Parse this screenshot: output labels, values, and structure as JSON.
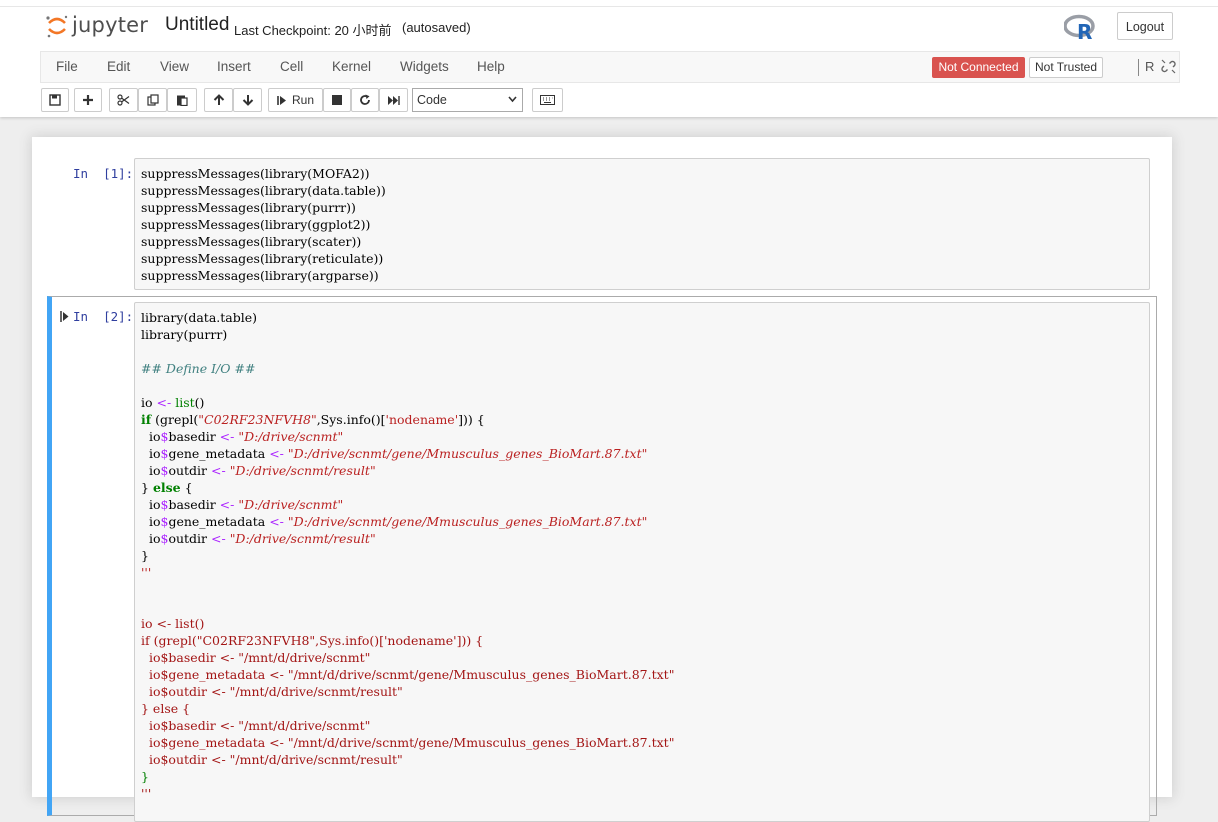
{
  "header": {
    "logo_text": "jupyter",
    "notebook_title": "Untitled",
    "checkpoint": "Last Checkpoint: 20 小时前",
    "autosave": "(autosaved)",
    "logout_label": "Logout",
    "kernel_logo": "R"
  },
  "menubar": {
    "items": [
      "File",
      "Edit",
      "View",
      "Insert",
      "Cell",
      "Kernel",
      "Widgets",
      "Help"
    ],
    "connection_status": "Not Connected",
    "trust_status": "Not Trusted",
    "kernel_name": "R",
    "status_colors": {
      "not_connected_bg": "#d9534f"
    }
  },
  "toolbar": {
    "buttons": [
      "save-icon",
      "plus-icon",
      "cut-icon",
      "copy-icon",
      "paste-icon",
      "arrow-up-icon",
      "arrow-down-icon",
      "run-button",
      "stop-icon",
      "restart-icon",
      "fast-forward-icon",
      "keyboard-icon"
    ],
    "run_label": "Run",
    "cell_type": "Code"
  },
  "cells": [
    {
      "prompt": "In  [1]:",
      "lines": [
        "suppressMessages(library(MOFA2))",
        "suppressMessages(library(data.table))",
        "suppressMessages(library(purrr))",
        "suppressMessages(library(ggplot2))",
        "suppressMessages(library(scater))",
        "suppressMessages(library(reticulate))",
        "suppressMessages(library(argparse))"
      ]
    },
    {
      "prompt": "In  [2]:",
      "code": {
        "l1": "library(data.table)",
        "l2": "library(purrr)",
        "comment": "## Define I/O ##",
        "io": "io",
        "assign": "<-",
        "list": "list",
        "paren": "()",
        "if": "if",
        "grepl_open": " (grepl(",
        "host": "\"C02RF23NFVH8\"",
        "sysinfo": ",Sys.info()[",
        "nodename": "'nodename'",
        "close": "])) {",
        "indent_io": "  io",
        "dollar": "$",
        "basedir": "basedir",
        "gene_metadata": "gene_metadata",
        "outdir": "outdir",
        "d_basedir": "\"D:/drive/scnmt\"",
        "d_gene": "\"D:/drive/scnmt/gene/Mmusculus_genes_BioMart.87.txt\"",
        "d_outdir": "\"D:/drive/scnmt/result\"",
        "else_open": "} ",
        "else": "else",
        "brace_open": " {",
        "brace_close": "}",
        "triple_quote": "'''",
        "raw_io": "io <- list()",
        "raw_if": "if (grepl(\"C02RF23NFVH8\",Sys.info()['nodename'])) {",
        "raw_basedir": "  io$basedir <- \"/mnt/d/drive/scnmt\"",
        "raw_gene": "  io$gene_metadata <- \"/mnt/d/drive/scnmt/gene/Mmusculus_genes_BioMart.87.txt\"",
        "raw_outdir": "  io$outdir <- \"/mnt/d/drive/scnmt/result\"",
        "raw_else": "} else {",
        "raw_close": "}",
        "raw_triple": "'''"
      }
    }
  ]
}
